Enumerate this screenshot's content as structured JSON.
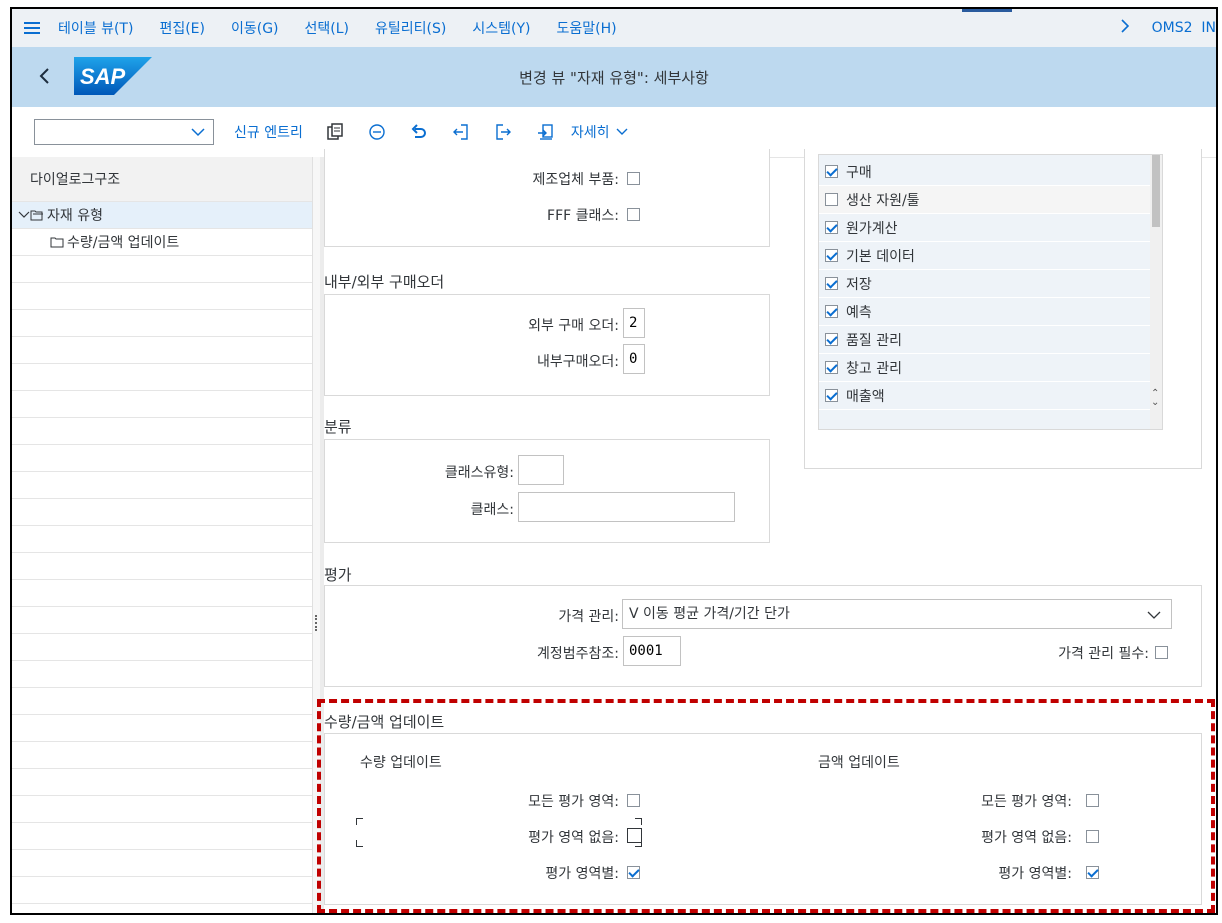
{
  "menubar": {
    "items": [
      "테이블 뷰(T)",
      "편집(E)",
      "이동(G)",
      "선택(L)",
      "유틸리티(S)",
      "시스템(Y)",
      "도움말(H)"
    ],
    "right_text": "OMS2  IN"
  },
  "header": {
    "logo_text": "SAP",
    "title": "변경 뷰 \"자재 유형\": 세부사항"
  },
  "toolbar": {
    "combo_value": "",
    "new_entries": "신규 엔트리",
    "more": "자세히"
  },
  "dialog_structure": {
    "header": "다이얼로그구조",
    "nodes": [
      {
        "label": "자재 유형",
        "expanded": true,
        "selected": true
      },
      {
        "label": "수량/금액 업데이트",
        "expanded": false,
        "selected": false
      }
    ]
  },
  "top_group": {
    "manufacturer_parts_label": "제조업체 부품:",
    "manufacturer_parts_checked": false,
    "fff_class_label": "FFF 클래스:",
    "fff_class_checked": false
  },
  "purchase_order": {
    "title": "내부/외부 구매오더",
    "external_label": "외부 구매 오더:",
    "external_value": "2",
    "internal_label": "내부구매오더:",
    "internal_value": "0"
  },
  "classification": {
    "title": "분류",
    "class_type_label": "클래스유형:",
    "class_type_value": "",
    "class_label": "클래스:",
    "class_value": ""
  },
  "valuation": {
    "title": "평가",
    "price_control_label": "가격 관리:",
    "price_control_value": "V 이동 평균 가격/기간 단가",
    "account_ref_label": "계정범주참조:",
    "account_ref_value": "0001",
    "price_control_mandatory_label": "가격 관리 필수:",
    "price_control_mandatory_checked": false
  },
  "views_list": {
    "items": [
      {
        "label": "구매",
        "checked": true
      },
      {
        "label": "생산 자원/툴",
        "checked": false
      },
      {
        "label": "원가계산",
        "checked": true
      },
      {
        "label": "기본 데이터",
        "checked": true
      },
      {
        "label": "저장",
        "checked": true
      },
      {
        "label": "예측",
        "checked": true
      },
      {
        "label": "품질 관리",
        "checked": true
      },
      {
        "label": "창고 관리",
        "checked": true
      },
      {
        "label": "매출액",
        "checked": true
      }
    ]
  },
  "qty_value_update": {
    "title": "수량/금액 업데이트",
    "qty_header": "수량 업데이트",
    "value_header": "금액 업데이트",
    "all_areas_label": "모든 평가 영역:",
    "no_area_label": "평가 영역 없음:",
    "by_area_label": "평가 영역별:",
    "qty": {
      "all_areas": false,
      "no_area": false,
      "by_area": true
    },
    "value": {
      "all_areas": false,
      "no_area": false,
      "by_area": true
    }
  },
  "colors": {
    "accent": "#0a6ed1",
    "header_bg": "#bdd9ef",
    "highlight": "#c00000"
  }
}
